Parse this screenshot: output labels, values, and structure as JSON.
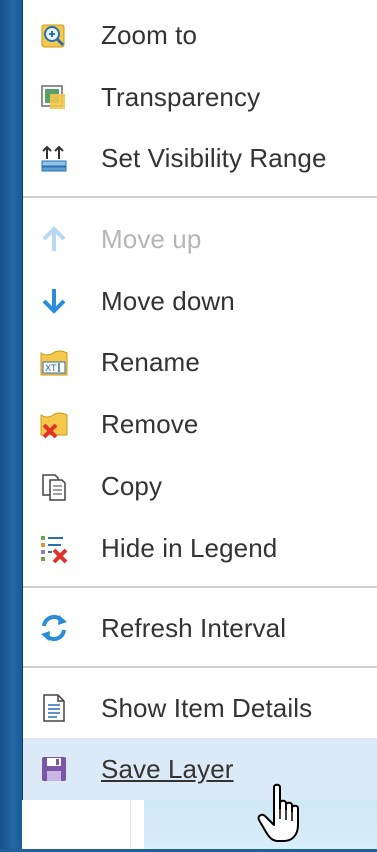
{
  "menu": {
    "items": [
      {
        "label": "Zoom to",
        "icon": "zoom-to-icon",
        "enabled": true
      },
      {
        "label": "Transparency",
        "icon": "transparency-icon",
        "enabled": true
      },
      {
        "label": "Set Visibility Range",
        "icon": "visibility-range-icon",
        "enabled": true
      },
      {
        "label": "Move up",
        "icon": "arrow-up-icon",
        "enabled": false
      },
      {
        "label": "Move down",
        "icon": "arrow-down-icon",
        "enabled": true
      },
      {
        "label": "Rename",
        "icon": "rename-icon",
        "enabled": true
      },
      {
        "label": "Remove",
        "icon": "remove-icon",
        "enabled": true
      },
      {
        "label": "Copy",
        "icon": "copy-icon",
        "enabled": true
      },
      {
        "label": "Hide in Legend",
        "icon": "hide-legend-icon",
        "enabled": true
      },
      {
        "label": "Refresh Interval",
        "icon": "refresh-icon",
        "enabled": true
      },
      {
        "label": "Show Item Details",
        "icon": "document-icon",
        "enabled": true
      },
      {
        "label": "Save Layer",
        "icon": "save-icon",
        "enabled": true,
        "hovered": true
      }
    ]
  },
  "colors": {
    "accent_blue": "#2b8cd8",
    "hover_bg": "#dbeaf6",
    "disabled_text": "#b5b5b5",
    "text": "#333333"
  },
  "cursor": "hand-pointer-icon"
}
